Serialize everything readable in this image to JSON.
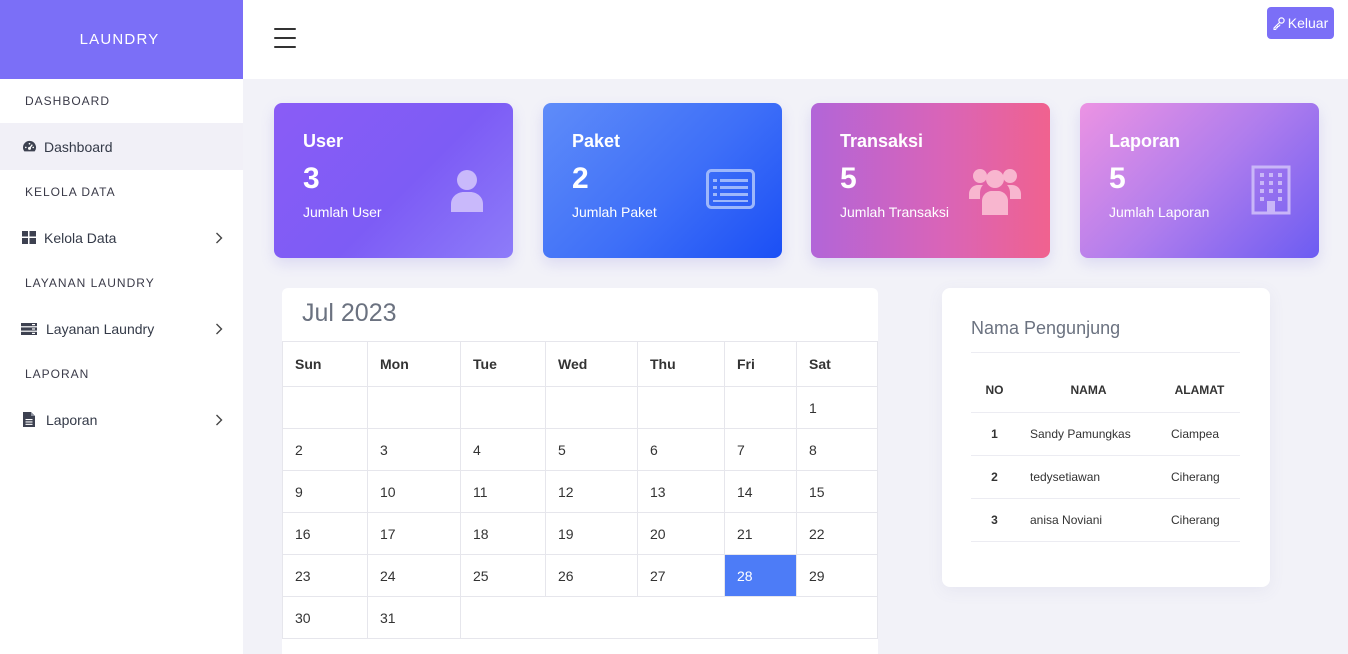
{
  "brand": "LAUNDRY",
  "sidebar": {
    "sections": [
      {
        "heading": "DASHBOARD",
        "item": {
          "label": "Dashboard",
          "icon": "dashboard-icon"
        }
      },
      {
        "heading": "KELOLA DATA",
        "item": {
          "label": "Kelola Data",
          "icon": "grid-icon"
        }
      },
      {
        "heading": "LAYANAN LAUNDRY",
        "item": {
          "label": "Layanan Laundry",
          "icon": "server-icon"
        }
      },
      {
        "heading": "LAPORAN",
        "item": {
          "label": "Laporan",
          "icon": "document-icon"
        }
      }
    ]
  },
  "header": {
    "logout_label": "Keluar"
  },
  "cards": [
    {
      "title": "User",
      "value": "3",
      "subtitle": "Jumlah User",
      "icon": "user-icon"
    },
    {
      "title": "Paket",
      "value": "2",
      "subtitle": "Jumlah Paket",
      "icon": "list-icon"
    },
    {
      "title": "Transaksi",
      "value": "5",
      "subtitle": "Jumlah Transaksi",
      "icon": "users-icon"
    },
    {
      "title": "Laporan",
      "value": "5",
      "subtitle": "Jumlah Laporan",
      "icon": "building-icon"
    }
  ],
  "calendar": {
    "title": "Jul 2023",
    "weekdays": [
      "Sun",
      "Mon",
      "Tue",
      "Wed",
      "Thu",
      "Fri",
      "Sat"
    ],
    "weeks": [
      [
        "",
        "",
        "",
        "",
        "",
        "",
        "1"
      ],
      [
        "2",
        "3",
        "4",
        "5",
        "6",
        "7",
        "8"
      ],
      [
        "9",
        "10",
        "11",
        "12",
        "13",
        "14",
        "15"
      ],
      [
        "16",
        "17",
        "18",
        "19",
        "20",
        "21",
        "22"
      ],
      [
        "23",
        "24",
        "25",
        "26",
        "27",
        "28",
        "29"
      ],
      [
        "30",
        "31"
      ]
    ],
    "today": "28"
  },
  "visitors": {
    "title": "Nama Pengunjung",
    "columns": [
      "NO",
      "NAMA",
      "ALAMAT"
    ],
    "rows": [
      {
        "no": "1",
        "nama": "Sandy Pamungkas",
        "alamat": "Ciampea"
      },
      {
        "no": "2",
        "nama": "tedysetiawan",
        "alamat": "Ciherang"
      },
      {
        "no": "3",
        "nama": "anisa Noviani",
        "alamat": "Ciherang"
      }
    ]
  },
  "colors": {
    "brand": "#7b6ff7",
    "today": "#4d7cf7"
  }
}
